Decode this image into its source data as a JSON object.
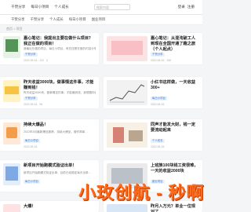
{
  "nav": {
    "items": [
      "千赞分享",
      "每日小项目",
      "个人成长"
    ],
    "search_placeholder": "搜索内容",
    "login": "登录",
    "register": "注册"
  },
  "tabs": [
    "千赞分享",
    "千赞分享",
    "个人成长",
    "每日小项目",
    "副业项目"
  ],
  "breadcrumb": "首页 > 项目",
  "cards": [
    {
      "title": "嘉心笔记：我提出主要在做什么项目？我正在做的项目！",
      "desc": "我最近在做的项目，每日小项目，有些还是在做的内容分享…",
      "tag": "千赞分享",
      "meta": [
        "2022-05-16",
        "122",
        "3"
      ]
    },
    {
      "title": "嘉心笔记：从混沌破工人到现在全国开通了趣之旅（个人起点）",
      "desc": "从混沌破工人到现在全国开通，在这段时间内经历了很多…",
      "tag": "千赞分享",
      "meta": [
        "2022-05-16",
        "108",
        "2"
      ]
    },
    {
      "title": "昨天收益3000块，做事情这件事，才能赚到钱！",
      "desc": "昨天收益3000块，做事情这件事，才能赚到钱，我想跟你们分享…",
      "tag": "千赞分享",
      "meta": [
        "2022-05-16",
        "96",
        "1"
      ]
    },
    {
      "title": "小红书这样做，一天收益300+",
      "desc": "小红书这样做，一天收益300+，具体操作方法分享给大家…",
      "tag": "每日小项目",
      "meta": [
        "2022-05-16",
        "88",
        "0"
      ]
    },
    {
      "title": "持续大爆品！",
      "desc": "2022年5月最新爆品推荐，持续大爆品，操作简单…",
      "tag": "每日小项目",
      "meta": [
        "2022-05-16",
        "76",
        "0"
      ]
    },
    {
      "title": "同声才能发大财，钱一定要流动起来",
      "desc": "同声才能发大财，钱一定要流动起来，这个道理我懂了…",
      "tag": "个人成长",
      "meta": [
        "2022-05-16",
        "70",
        "2"
      ]
    },
    {
      "title": "新项目开始跑模式验证出单！",
      "desc": "新项目开始跑模式验证出单，目前已经稳定每天出单…",
      "tag": "每日小项目",
      "meta": [
        "2022-05-16",
        "64",
        "1"
      ]
    },
    {
      "title": "上班族100块钱工资很难，一天的收益2000块",
      "desc": "上班族100块钱工资很难，一天的收益2000块…",
      "tag": "副业项目",
      "meta": [
        "2022-05-16",
        "58",
        "0"
      ]
    },
    {
      "title": "大爆！",
      "desc": "",
      "tag": "",
      "meta": []
    },
    {
      "title": "昨月入万元？单业一位现对了",
      "desc": "",
      "tag": "",
      "meta": []
    }
  ],
  "watermark": "小玫创航 - 秒啊",
  "colors": {
    "accent": "#3a7bd5",
    "watermark": "#ff6a1a",
    "background": "#f4f5f7"
  }
}
